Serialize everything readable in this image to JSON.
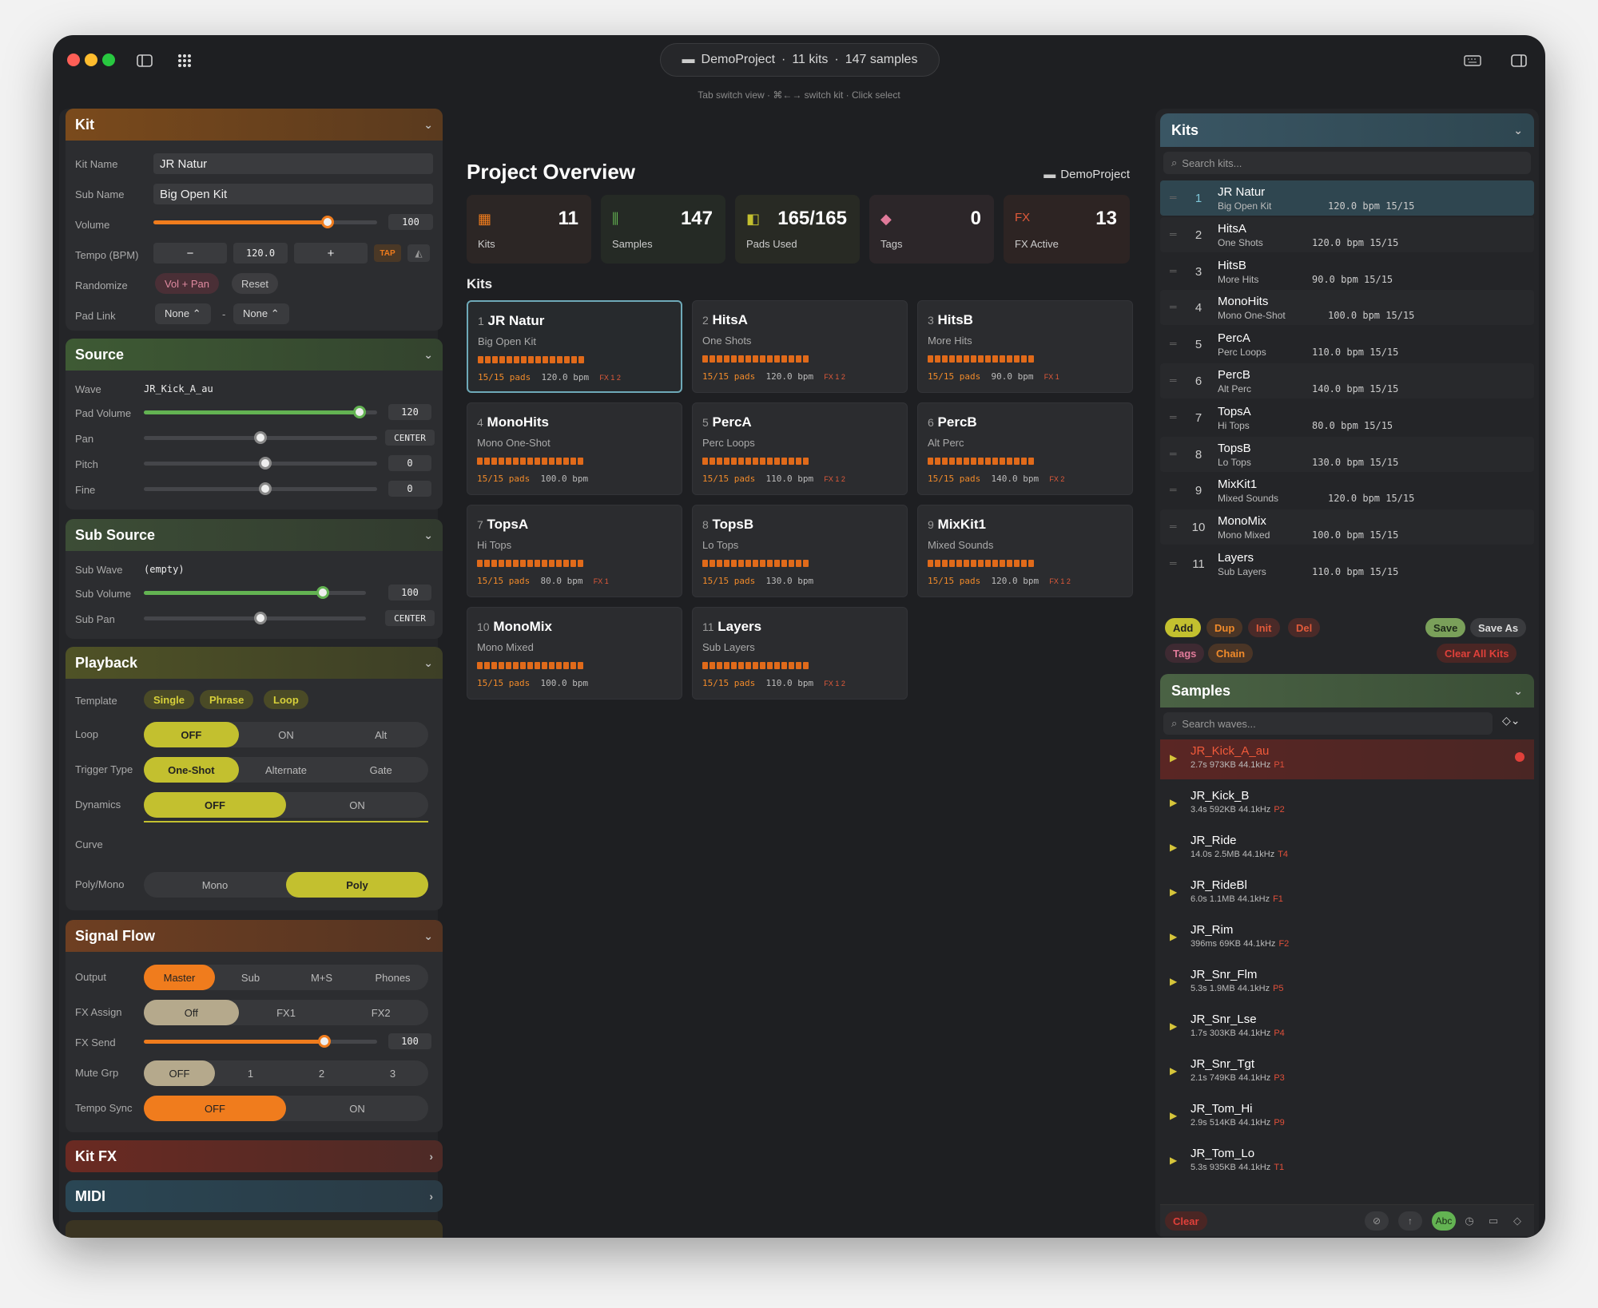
{
  "titlebar": {
    "project": "DemoProject",
    "kits_count": "11 kits",
    "samples_count": "147 samples",
    "sep": "·",
    "hint": "Tab switch view · ⌘←→ switch kit · Click select"
  },
  "left": {
    "kit": {
      "title": "Kit",
      "kit_name_label": "Kit Name",
      "kit_name": "JR Natur",
      "sub_name_label": "Sub Name",
      "sub_name": "Big Open Kit",
      "volume_label": "Volume",
      "volume": 100,
      "volume_value": "100",
      "tempo_label": "Tempo (BPM)",
      "tempo_minus": "−",
      "tempo_value": "120.0",
      "tempo_plus": "+",
      "tap": "TAP",
      "randomize_label": "Randomize",
      "rand_vol_pan": "Vol + Pan",
      "rand_reset": "Reset",
      "pad_link_label": "Pad Link",
      "pad_link_a": "None ⌃",
      "pad_link_dash": "-",
      "pad_link_b": "None ⌃"
    },
    "source": {
      "title": "Source",
      "wave_label": "Wave",
      "wave": "JR_Kick_A_au",
      "pad_volume_label": "Pad Volume",
      "pad_volume": 120,
      "pad_volume_value": "120",
      "pan_label": "Pan",
      "pan_value": "CENTER",
      "pitch_label": "Pitch",
      "pitch_value": "0",
      "fine_label": "Fine",
      "fine_value": "0"
    },
    "sub_source": {
      "title": "Sub Source",
      "sub_wave_label": "Sub Wave",
      "sub_wave": "(empty)",
      "sub_volume_label": "Sub Volume",
      "sub_volume": 100,
      "sub_volume_value": "100",
      "sub_pan_label": "Sub Pan",
      "sub_pan_value": "CENTER"
    },
    "playback": {
      "title": "Playback",
      "template_label": "Template",
      "templates": [
        "Single",
        "Phrase",
        "Loop"
      ],
      "loop_label": "Loop",
      "loop_options": [
        "OFF",
        "ON",
        "Alt"
      ],
      "trigger_label": "Trigger Type",
      "trigger_options": [
        "One-Shot",
        "Alternate",
        "Gate"
      ],
      "dynamics_label": "Dynamics",
      "dynamics_options": [
        "OFF",
        "ON"
      ],
      "curve_label": "Curve",
      "polymono_label": "Poly/Mono",
      "polymono_options": [
        "Mono",
        "Poly"
      ]
    },
    "signal_flow": {
      "title": "Signal Flow",
      "output_label": "Output",
      "output_options": [
        "Master",
        "Sub",
        "M+S",
        "Phones"
      ],
      "fx_assign_label": "FX Assign",
      "fx_assign_options": [
        "Off",
        "FX1",
        "FX2"
      ],
      "fx_send_label": "FX Send",
      "fx_send": 100,
      "fx_send_value": "100",
      "mute_grp_label": "Mute Grp",
      "mute_grp_options": [
        "OFF",
        "1",
        "2",
        "3"
      ],
      "tempo_sync_label": "Tempo Sync",
      "tempo_sync_options": [
        "OFF",
        "ON"
      ]
    },
    "kit_fx": {
      "title": "Kit FX"
    },
    "midi": {
      "title": "MIDI"
    }
  },
  "center": {
    "title": "Project Overview",
    "project": "DemoProject",
    "stats": [
      {
        "value": "11",
        "label": "Kits"
      },
      {
        "value": "147",
        "label": "Samples"
      },
      {
        "value": "165/165",
        "label": "Pads Used"
      },
      {
        "value": "0",
        "label": "Tags"
      },
      {
        "value": "13",
        "label": "FX Active",
        "icon_text": "FX"
      }
    ],
    "kits_heading": "Kits",
    "kits": [
      {
        "n": "1",
        "name": "JR Natur",
        "sub": "Big Open Kit",
        "pads": "15/15 pads",
        "bpm": "120.0 bpm",
        "fx": "FX 1 2"
      },
      {
        "n": "2",
        "name": "HitsA",
        "sub": "One Shots",
        "pads": "15/15 pads",
        "bpm": "120.0 bpm",
        "fx": "FX 1 2"
      },
      {
        "n": "3",
        "name": "HitsB",
        "sub": "More Hits",
        "pads": "15/15 pads",
        "bpm": "90.0 bpm",
        "fx": "FX 1"
      },
      {
        "n": "4",
        "name": "MonoHits",
        "sub": "Mono One-Shot",
        "pads": "15/15 pads",
        "bpm": "100.0 bpm",
        "fx": ""
      },
      {
        "n": "5",
        "name": "PercA",
        "sub": "Perc Loops",
        "pads": "15/15 pads",
        "bpm": "110.0 bpm",
        "fx": "FX 1 2"
      },
      {
        "n": "6",
        "name": "PercB",
        "sub": "Alt Perc",
        "pads": "15/15 pads",
        "bpm": "140.0 bpm",
        "fx": "FX 2"
      },
      {
        "n": "7",
        "name": "TopsA",
        "sub": "Hi Tops",
        "pads": "15/15 pads",
        "bpm": "80.0 bpm",
        "fx": "FX 1"
      },
      {
        "n": "8",
        "name": "TopsB",
        "sub": "Lo Tops",
        "pads": "15/15 pads",
        "bpm": "130.0 bpm",
        "fx": ""
      },
      {
        "n": "9",
        "name": "MixKit1",
        "sub": "Mixed Sounds",
        "pads": "15/15 pads",
        "bpm": "120.0 bpm",
        "fx": "FX 1 2"
      },
      {
        "n": "10",
        "name": "MonoMix",
        "sub": "Mono Mixed",
        "pads": "15/15 pads",
        "bpm": "100.0 bpm",
        "fx": ""
      },
      {
        "n": "11",
        "name": "Layers",
        "sub": "Sub Layers",
        "pads": "15/15 pads",
        "bpm": "110.0 bpm",
        "fx": "FX 1 2"
      }
    ]
  },
  "right": {
    "kits_title": "Kits",
    "kits_search_placeholder": "Search kits...",
    "kits": [
      {
        "n": "1",
        "name": "JR Natur",
        "sub": "Big Open Kit",
        "meta": "120.0 bpm 15/15"
      },
      {
        "n": "2",
        "name": "HitsA",
        "sub": "One Shots",
        "meta": "120.0 bpm 15/15"
      },
      {
        "n": "3",
        "name": "HitsB",
        "sub": "More Hits",
        "meta": "90.0 bpm 15/15"
      },
      {
        "n": "4",
        "name": "MonoHits",
        "sub": "Mono One-Shot",
        "meta": "100.0 bpm 15/15"
      },
      {
        "n": "5",
        "name": "PercA",
        "sub": "Perc Loops",
        "meta": "110.0 bpm 15/15"
      },
      {
        "n": "6",
        "name": "PercB",
        "sub": "Alt Perc",
        "meta": "140.0 bpm 15/15"
      },
      {
        "n": "7",
        "name": "TopsA",
        "sub": "Hi Tops",
        "meta": "80.0 bpm 15/15"
      },
      {
        "n": "8",
        "name": "TopsB",
        "sub": "Lo Tops",
        "meta": "130.0 bpm 15/15"
      },
      {
        "n": "9",
        "name": "MixKit1",
        "sub": "Mixed Sounds",
        "meta": "120.0 bpm 15/15"
      },
      {
        "n": "10",
        "name": "MonoMix",
        "sub": "Mono Mixed",
        "meta": "100.0 bpm 15/15"
      },
      {
        "n": "11",
        "name": "Layers",
        "sub": "Sub Layers",
        "meta": "110.0 bpm 15/15"
      }
    ],
    "kit_actions": {
      "add": "Add",
      "dup": "Dup",
      "init": "Init",
      "del": "Del",
      "save": "Save",
      "save_as": "Save As",
      "tags": "Tags",
      "chain": "Chain",
      "clear_all": "Clear All Kits"
    },
    "samples_title": "Samples",
    "samples_search_placeholder": "Search waves...",
    "samples": [
      {
        "name": "JR_Kick_A_au",
        "len": "2.7s",
        "size": "973KB",
        "rate": "44.1kHz",
        "pad": "P1"
      },
      {
        "name": "JR_Kick_B",
        "len": "3.4s",
        "size": "592KB",
        "rate": "44.1kHz",
        "pad": "P2"
      },
      {
        "name": "JR_Ride",
        "len": "14.0s",
        "size": "2.5MB",
        "rate": "44.1kHz",
        "pad": "T4"
      },
      {
        "name": "JR_RideBl",
        "len": "6.0s",
        "size": "1.1MB",
        "rate": "44.1kHz",
        "pad": "F1"
      },
      {
        "name": "JR_Rim",
        "len": "396ms",
        "size": "69KB",
        "rate": "44.1kHz",
        "pad": "F2"
      },
      {
        "name": "JR_Snr_Flm",
        "len": "5.3s",
        "size": "1.9MB",
        "rate": "44.1kHz",
        "pad": "P5"
      },
      {
        "name": "JR_Snr_Lse",
        "len": "1.7s",
        "size": "303KB",
        "rate": "44.1kHz",
        "pad": "P4"
      },
      {
        "name": "JR_Snr_Tgt",
        "len": "2.1s",
        "size": "749KB",
        "rate": "44.1kHz",
        "pad": "P3"
      },
      {
        "name": "JR_Tom_Hi",
        "len": "2.9s",
        "size": "514KB",
        "rate": "44.1kHz",
        "pad": "P9"
      },
      {
        "name": "JR_Tom_Lo",
        "len": "5.3s",
        "size": "935KB",
        "rate": "44.1kHz",
        "pad": "T1"
      }
    ],
    "clear": "Clear",
    "abc": "Abc"
  },
  "colors": {
    "kit_head": "#7a4a1c",
    "source_head": "#3e5a34",
    "sub_source_head": "#3c4d36",
    "playback_head": "#4f5226",
    "signal_head": "#6e3f22",
    "kitfx_head": "#6a2a22",
    "midi_head": "#2a4654",
    "accent_orange": "#f07c1d",
    "accent_yellow": "#c3c02f",
    "accent_green": "#63b352"
  }
}
